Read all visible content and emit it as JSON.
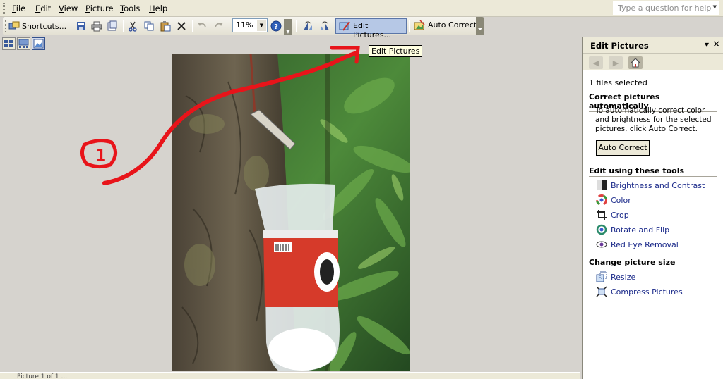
{
  "menu": {
    "items": [
      {
        "label": "File",
        "key": "F",
        "rest": "ile"
      },
      {
        "label": "Edit",
        "key": "E",
        "rest": "dit"
      },
      {
        "label": "View",
        "key": "V",
        "rest": "iew"
      },
      {
        "label": "Picture",
        "key": "P",
        "rest": "icture"
      },
      {
        "label": "Tools",
        "key": "T",
        "rest": "ools"
      },
      {
        "label": "Help",
        "key": "H",
        "rest": "elp"
      }
    ],
    "question_placeholder": "Type a question for help"
  },
  "toolbar": {
    "shortcuts_label": "Shortcuts...",
    "zoom_value": "11%",
    "edit_pictures_label": "Edit Pictures...",
    "auto_correct_label": "Auto Correct"
  },
  "tooltip": "Edit Pictures",
  "annotation": {
    "label": "1"
  },
  "status": {
    "text": "Picture 1 of 1 ..."
  },
  "pane": {
    "title": "Edit Pictures",
    "files_selected": "1 files selected",
    "auto_section_title": "Correct pictures automatically",
    "auto_section_text": "To automatically correct color and brightness for the selected pictures, click Auto Correct.",
    "auto_correct_button": "Auto Correct",
    "tools_section_title": "Edit using these tools",
    "tools": [
      {
        "label": "Brightness and Contrast",
        "icon": "brightness-icon"
      },
      {
        "label": "Color",
        "icon": "color-icon"
      },
      {
        "label": "Crop",
        "icon": "crop-icon"
      },
      {
        "label": "Rotate and Flip",
        "icon": "rotate-icon"
      },
      {
        "label": "Red Eye Removal",
        "icon": "eye-icon"
      }
    ],
    "size_section_title": "Change picture size",
    "size_tools": [
      {
        "label": "Resize",
        "icon": "resize-icon"
      },
      {
        "label": "Compress Pictures",
        "icon": "compress-icon"
      }
    ]
  },
  "colors": {
    "annotation": "#e8141a",
    "link": "#1b2a8a",
    "selected_button": "#b6c8e6"
  }
}
